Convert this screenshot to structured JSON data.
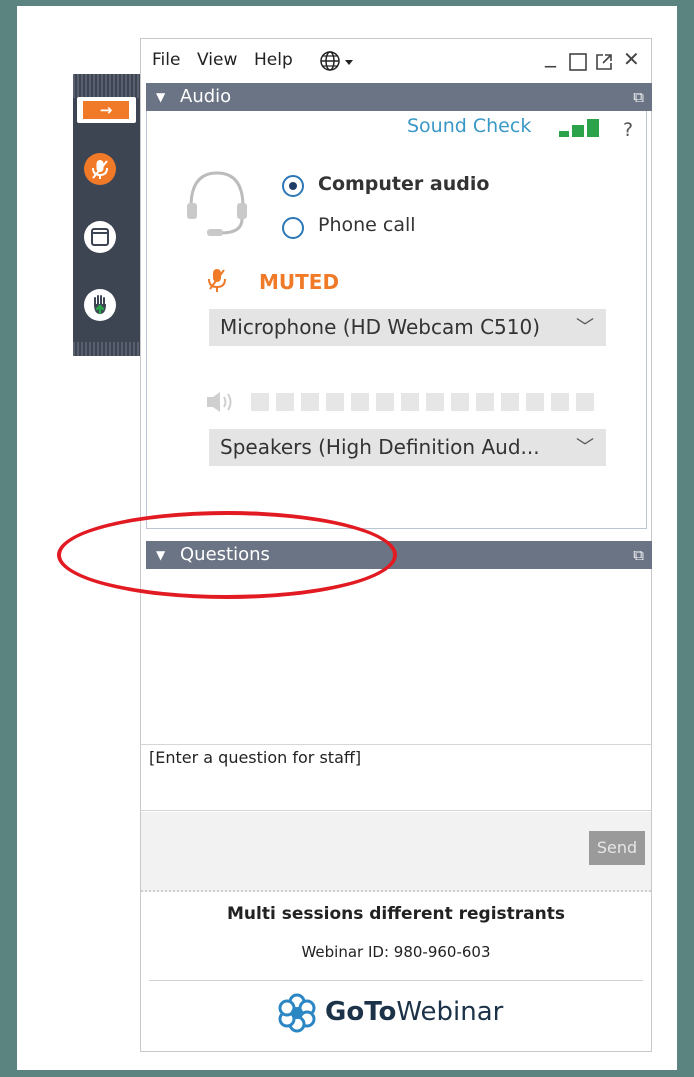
{
  "menubar": {
    "file": "File",
    "view": "View",
    "help": "Help",
    "globe_icon": "globe-icon",
    "minimize": "_",
    "close": "✕"
  },
  "audio": {
    "header": "Audio",
    "sound_check": "Sound Check",
    "help_mark": "?",
    "computer_audio": "Computer audio",
    "phone_call": "Phone call",
    "selected": "Computer audio",
    "muted_label": "MUTED",
    "microphone": "Microphone (HD Webcam C510)",
    "speakers": "Speakers (High Definition Aud..."
  },
  "questions": {
    "header": "Questions",
    "placeholder": "[Enter a question for staff]",
    "send": "Send"
  },
  "footer": {
    "title": "Multi sessions different registrants",
    "webinar_id": "Webinar ID: 980-960-603",
    "brand_bold": "GoTo",
    "brand_rest": "Webinar"
  },
  "colors": {
    "accent_orange": "#f07a28",
    "header_gray": "#6b7485",
    "signal_green": "#2aa34a",
    "link_blue": "#3a98c6",
    "annotation_red": "#e21b23"
  }
}
